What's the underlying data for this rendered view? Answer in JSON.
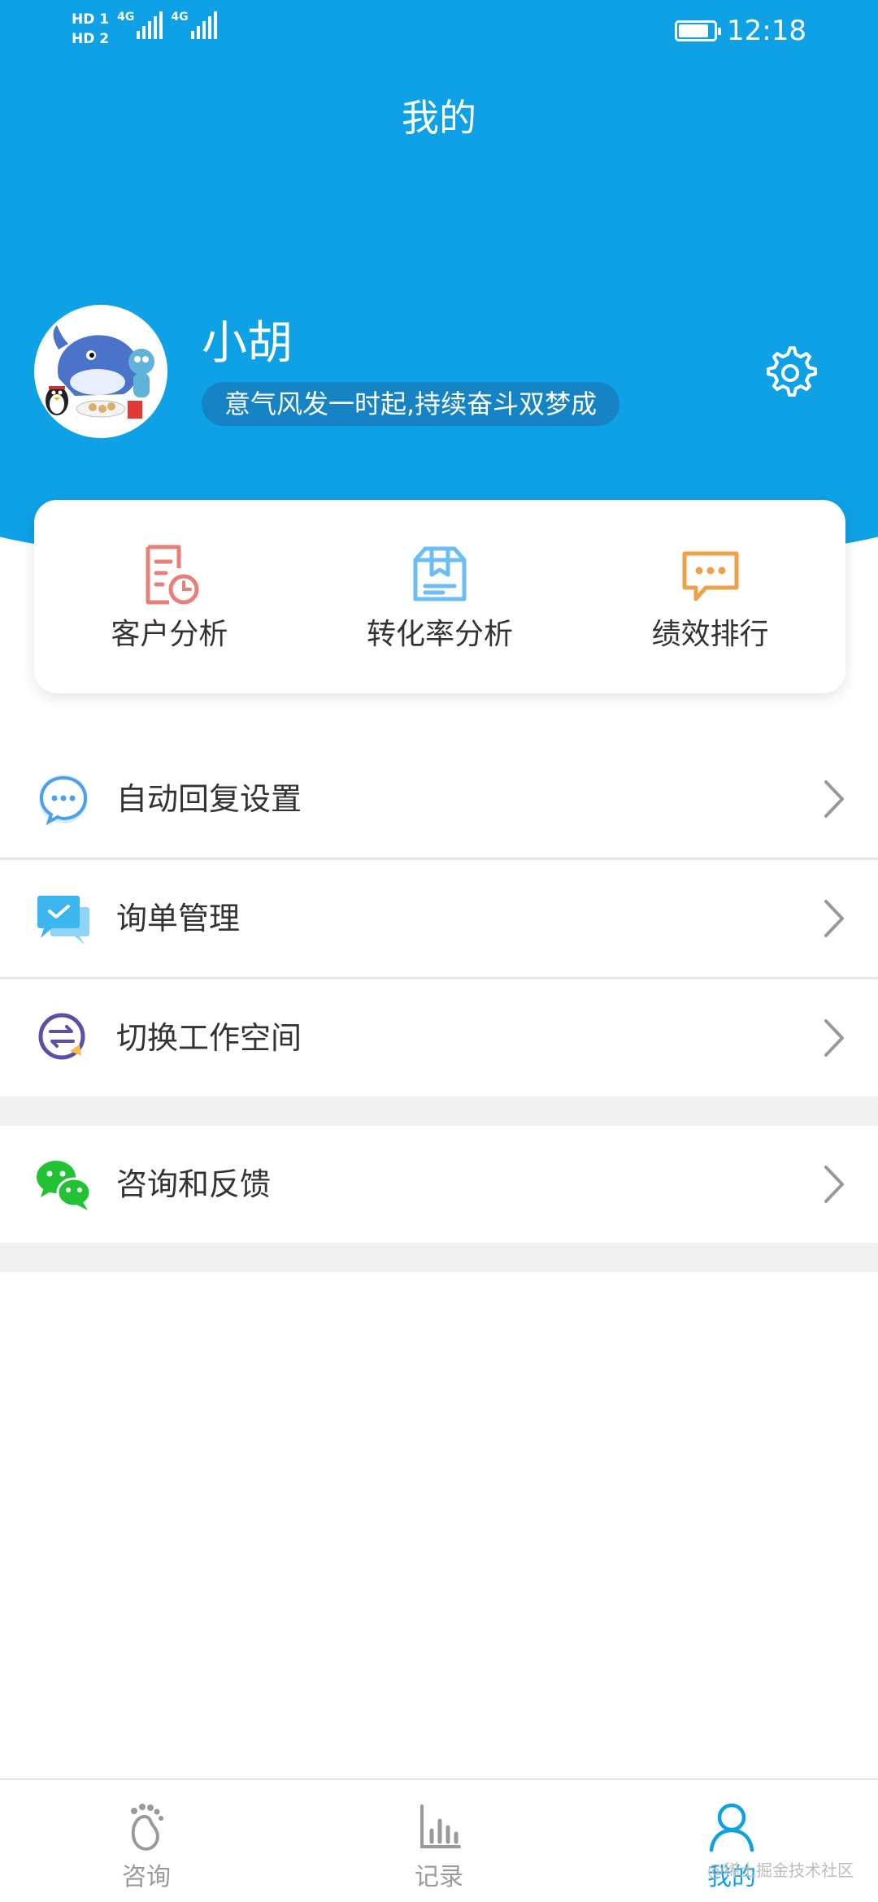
{
  "status_bar": {
    "sim1": "HD 1",
    "sim2": "HD 2",
    "net1": "4G",
    "net2": "4G",
    "time": "12:18",
    "battery_level": 0.9
  },
  "header": {
    "title": "我的"
  },
  "profile": {
    "name": "小胡",
    "motto": "意气风发一时起,持续奋斗双梦成"
  },
  "quick_actions": [
    {
      "label": "客户分析",
      "icon": "customer-report-icon",
      "color": "#e8807a"
    },
    {
      "label": "转化率分析",
      "icon": "box-icon",
      "color": "#6cbdf2"
    },
    {
      "label": "绩效排行",
      "icon": "chat-bubble-icon",
      "color": "#f0a04b"
    }
  ],
  "menu": [
    {
      "label": "自动回复设置",
      "icon": "auto-reply-icon"
    },
    {
      "label": "询单管理",
      "icon": "inquiry-icon"
    },
    {
      "label": "切换工作空间",
      "icon": "switch-workspace-icon"
    },
    {
      "label": "咨询和反馈",
      "icon": "wechat-icon"
    }
  ],
  "tabs": [
    {
      "label": "咨询",
      "icon": "footprint-icon",
      "active": false
    },
    {
      "label": "记录",
      "icon": "bar-chart-icon",
      "active": false
    },
    {
      "label": "我的",
      "icon": "person-icon",
      "active": true
    }
  ],
  "watermark": "@稀土掘金技术社区",
  "colors": {
    "brand": "#0ea1e6",
    "motto_bg": "#1583c4",
    "active_tab": "#0ea1e6",
    "inactive_tab": "#9a9a9a"
  }
}
